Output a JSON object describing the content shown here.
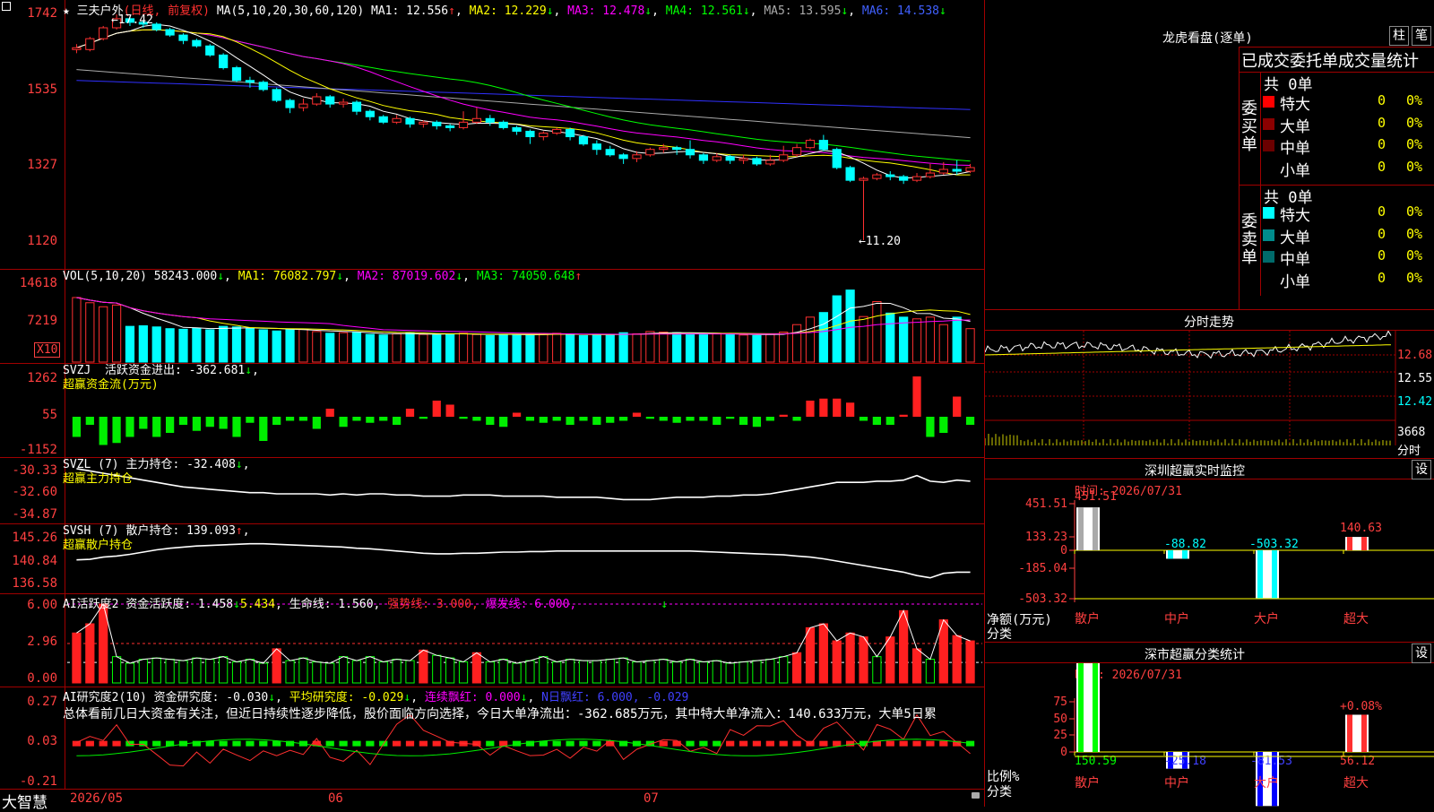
{
  "main_panel": {
    "title_icon": "star-icon",
    "stock_name": "三夫户外",
    "period": "(日线, 前复权)",
    "ma_header": "MA(5,10,20,30,60,120)",
    "ma1": "MA1: 12.556",
    "ma2": "MA2: 12.229",
    "ma3": "MA3: 12.478",
    "ma4": "MA4: 12.561",
    "ma5": "MA5: 13.595",
    "ma6": "MA6: 14.538",
    "high_label": "17.42",
    "low_label": "11.20",
    "y_ticks": [
      "1742",
      "1535",
      "1327",
      "1120"
    ],
    "colors": {
      "up": "#ff3030",
      "down": "#00ffff",
      "ma1": "#ffffff",
      "ma2": "#ffff00",
      "ma3": "#ff00ff",
      "ma4": "#00ff00",
      "ma5": "#aaaaaa",
      "ma6": "#3030ff"
    }
  },
  "vol_panel": {
    "header": "VOL(5,10,20)",
    "value": "58243.000",
    "ma1": "MA1: 76082.797",
    "ma2": "MA2: 87019.602",
    "ma3": "MA3: 74050.648",
    "y_ticks": [
      "14618",
      "7219"
    ],
    "unit": "X10"
  },
  "svzj_panel": {
    "header": "SVZJ",
    "line1": "活跃资金进出: -362.681",
    "line2": "超赢资金流(万元)",
    "y_ticks": [
      "1262",
      "55",
      "-1152"
    ]
  },
  "svzl_panel": {
    "header": "SVZL (7)",
    "line1": "主力持仓: -32.408",
    "line2": "超赢主力持仓",
    "y_ticks": [
      "-30.33",
      "-32.60",
      "-34.87"
    ]
  },
  "svsh_panel": {
    "header": "SVSH (7)",
    "line1": "散户持仓: 139.093",
    "line2": "超赢散户持仓",
    "y_ticks": [
      "145.26",
      "140.84",
      "136.58"
    ]
  },
  "ai_active_panel": {
    "header": "AI活跃度2",
    "line1": "资金活跃度: 1.458",
    "line2": "5.434",
    "line3": "生命线: 1.560,",
    "line4": "强势线: 3.000,",
    "line5": "爆发线: 6.000,",
    "y_ticks": [
      "6.00",
      "2.96",
      "0.00"
    ]
  },
  "ai_research_panel": {
    "header": "AI研究度2(10)",
    "line1": "资金研究度: -0.030",
    "line2": "平均研究度: -0.029",
    "line3": "连续飘红: 0.000",
    "line4": "N日飘红: 6.000, -0.029",
    "summary": "总体看前几日大资金有关注，但近日持续性逐步降低，股价面临方向选择，今日大单净流出：-362.685万元，其中特大单净流入：140.633万元，大单5日累",
    "y_ticks": [
      "0.27",
      "0.03",
      "-0.21"
    ]
  },
  "bottom_bar": {
    "brand": "大智慧",
    "dates": [
      "2026/05",
      "06",
      "07"
    ],
    "lock_icon": "lock-icon"
  },
  "longhu": {
    "title": "龙虎看盘(逐单)",
    "btn_bar": "柱",
    "btn_tick": "笔",
    "header": "已成交委托单成交量统计",
    "buy_total": "共 0单",
    "buy_label": "委买单",
    "sell_total": "共 0单",
    "sell_label": "委卖单",
    "buy_rows": [
      {
        "label": "特大",
        "count": "0",
        "pct": "0%",
        "color": "#ff0000"
      },
      {
        "label": "大单",
        "count": "0",
        "pct": "0%",
        "color": "#8b0000"
      },
      {
        "label": "中单",
        "count": "0",
        "pct": "0%",
        "color": "#6b0000"
      },
      {
        "label": "小单",
        "count": "0",
        "pct": "0%",
        "color": "#000000"
      }
    ],
    "sell_rows": [
      {
        "label": "特大",
        "count": "0",
        "pct": "0%",
        "color": "#00ffff"
      },
      {
        "label": "大单",
        "count": "0",
        "pct": "0%",
        "color": "#008b8b"
      },
      {
        "label": "中单",
        "count": "0",
        "pct": "0%",
        "color": "#006b6b"
      },
      {
        "label": "小单",
        "count": "0",
        "pct": "0%",
        "color": "#000000"
      }
    ]
  },
  "intraday": {
    "title": "分时走势",
    "y_ticks": [
      "12.68",
      "12.55",
      "12.42"
    ],
    "vol_tick": "3668",
    "vol_label": "分时"
  },
  "sz_monitor": {
    "title": "深圳超赢实时监控",
    "set_btn": "设",
    "time": "时间: 2026/07/31",
    "y_ticks": [
      "451.51",
      "133.23",
      "0",
      "-185.04",
      "-503.32"
    ],
    "unit_label": "净额(万元)",
    "cat_label": "分类",
    "categories": [
      "散户",
      "中户",
      "大户",
      "超大"
    ],
    "values": [
      "451.51",
      "-88.82",
      "-503.32",
      "140.63"
    ]
  },
  "sz_classify": {
    "title": "深市超赢分类统计",
    "set_btn": "设",
    "time": "时间: 2026/07/31",
    "y_ticks": [
      "75",
      "50",
      "25",
      "0"
    ],
    "unit_label": "比例%",
    "cat_label": "分类",
    "categories": [
      "散户",
      "中户",
      "大户",
      "超大"
    ],
    "values": [
      "150.59",
      "-25.18",
      "-81.53",
      "56.12"
    ],
    "top_value": "+0.08%"
  },
  "candles": [
    [
      16.45,
      16.5,
      16.35,
      16.6
    ],
    [
      16.45,
      16.75,
      16.4,
      16.8
    ],
    [
      16.75,
      17.05,
      16.7,
      17.1
    ],
    [
      17.05,
      17.3,
      17.0,
      17.42
    ],
    [
      17.3,
      17.2,
      17.1,
      17.35
    ],
    [
      17.2,
      17.15,
      17.05,
      17.25
    ],
    [
      17.15,
      17.0,
      16.95,
      17.2
    ],
    [
      17.0,
      16.85,
      16.8,
      17.05
    ],
    [
      16.85,
      16.7,
      16.6,
      16.9
    ],
    [
      16.7,
      16.55,
      16.5,
      16.75
    ],
    [
      16.55,
      16.3,
      16.25,
      16.6
    ],
    [
      16.3,
      15.95,
      15.9,
      16.35
    ],
    [
      15.95,
      15.6,
      15.55,
      16.0
    ],
    [
      15.6,
      15.55,
      15.4,
      15.7
    ],
    [
      15.55,
      15.35,
      15.3,
      15.6
    ],
    [
      15.35,
      15.05,
      15.0,
      15.4
    ],
    [
      15.05,
      14.85,
      14.7,
      15.1
    ],
    [
      14.85,
      14.95,
      14.75,
      15.1
    ],
    [
      14.95,
      15.15,
      14.9,
      15.25
    ],
    [
      15.15,
      14.95,
      14.85,
      15.2
    ],
    [
      14.95,
      15.0,
      14.85,
      15.1
    ],
    [
      15.0,
      14.75,
      14.65,
      15.05
    ],
    [
      14.75,
      14.6,
      14.5,
      14.8
    ],
    [
      14.6,
      14.45,
      14.4,
      14.65
    ],
    [
      14.45,
      14.55,
      14.4,
      14.65
    ],
    [
      14.55,
      14.4,
      14.3,
      14.6
    ],
    [
      14.4,
      14.45,
      14.3,
      14.5
    ],
    [
      14.45,
      14.35,
      14.25,
      14.5
    ],
    [
      14.35,
      14.3,
      14.2,
      14.4
    ],
    [
      14.3,
      14.45,
      14.25,
      14.75
    ],
    [
      14.45,
      14.55,
      14.4,
      14.85
    ],
    [
      14.55,
      14.45,
      14.35,
      14.65
    ],
    [
      14.45,
      14.3,
      14.25,
      14.5
    ],
    [
      14.3,
      14.2,
      14.1,
      14.35
    ],
    [
      14.2,
      14.05,
      13.85,
      14.25
    ],
    [
      14.05,
      14.15,
      13.95,
      14.2
    ],
    [
      14.15,
      14.25,
      14.1,
      14.3
    ],
    [
      14.25,
      14.05,
      13.95,
      14.3
    ],
    [
      14.05,
      13.85,
      13.8,
      14.1
    ],
    [
      13.85,
      13.7,
      13.55,
      13.95
    ],
    [
      13.7,
      13.55,
      13.5,
      13.8
    ],
    [
      13.55,
      13.45,
      13.3,
      13.6
    ],
    [
      13.45,
      13.55,
      13.35,
      13.65
    ],
    [
      13.55,
      13.7,
      13.5,
      13.75
    ],
    [
      13.7,
      13.75,
      13.6,
      13.85
    ],
    [
      13.75,
      13.7,
      13.55,
      13.8
    ],
    [
      13.7,
      13.55,
      13.45,
      13.95
    ],
    [
      13.55,
      13.4,
      13.3,
      13.6
    ],
    [
      13.4,
      13.5,
      13.35,
      13.6
    ],
    [
      13.5,
      13.4,
      13.3,
      13.55
    ],
    [
      13.4,
      13.45,
      13.3,
      13.55
    ],
    [
      13.45,
      13.3,
      13.25,
      13.5
    ],
    [
      13.3,
      13.4,
      13.25,
      13.55
    ],
    [
      13.4,
      13.55,
      13.35,
      13.8
    ],
    [
      13.55,
      13.75,
      13.5,
      13.85
    ],
    [
      13.75,
      13.95,
      13.7,
      14.0
    ],
    [
      13.95,
      13.7,
      13.65,
      14.1
    ],
    [
      13.7,
      13.2,
      13.15,
      13.75
    ],
    [
      13.2,
      12.85,
      12.8,
      13.25
    ],
    [
      12.85,
      12.9,
      11.2,
      12.95
    ],
    [
      12.9,
      13.0,
      12.85,
      13.05
    ],
    [
      13.0,
      12.95,
      12.85,
      13.1
    ],
    [
      12.95,
      12.85,
      12.75,
      13.0
    ],
    [
      12.85,
      12.95,
      12.8,
      13.05
    ],
    [
      12.95,
      13.05,
      12.9,
      13.3
    ],
    [
      13.05,
      13.15,
      13.0,
      13.35
    ],
    [
      13.15,
      13.1,
      13.0,
      13.4
    ],
    [
      13.1,
      13.2,
      13.05,
      13.3
    ]
  ],
  "volumes": [
    11200,
    10300,
    9600,
    9900,
    6200,
    6300,
    6100,
    5800,
    5700,
    5900,
    5600,
    6200,
    6100,
    5900,
    5600,
    5400,
    5600,
    5700,
    5300,
    5000,
    5100,
    5200,
    4800,
    4700,
    4900,
    5100,
    4800,
    4700,
    4900,
    5000,
    4800,
    4600,
    4800,
    4700,
    4800,
    4900,
    5000,
    4800,
    4600,
    4700,
    4800,
    5100,
    4900,
    5300,
    5200,
    5100,
    4900,
    4800,
    5000,
    4800,
    4700,
    4600,
    4800,
    5200,
    6500,
    7800,
    8600,
    11500,
    12500,
    7900,
    10500,
    8500,
    7800,
    7500,
    7800,
    6500,
    7800,
    5800
  ],
  "svzj": [
    -500,
    -200,
    -700,
    -650,
    -500,
    -300,
    -500,
    -400,
    -200,
    -350,
    -250,
    -300,
    -500,
    -150,
    -600,
    -200,
    -100,
    -100,
    -300,
    200,
    -250,
    -100,
    -150,
    -100,
    -200,
    200,
    -50,
    400,
    300,
    -50,
    -100,
    -200,
    -250,
    100,
    -100,
    -150,
    -100,
    -200,
    -100,
    -200,
    -150,
    -100,
    100,
    -50,
    -100,
    -150,
    -100,
    -100,
    -200,
    -50,
    -200,
    -250,
    -100,
    50,
    -100,
    400,
    450,
    450,
    350,
    -100,
    -200,
    -200,
    50,
    1000,
    -500,
    -400,
    500,
    -200,
    -250,
    -300
  ],
  "svzl": [
    -30.4,
    -30.6,
    -30.8,
    -31.0,
    -31.2,
    -31.4,
    -31.6,
    -31.8,
    -32.0,
    -32.1,
    -32.2,
    -32.3,
    -32.4,
    -32.5,
    -32.5,
    -32.6,
    -32.6,
    -32.6,
    -32.6,
    -32.7,
    -32.6,
    -32.7,
    -32.6,
    -32.6,
    -32.7,
    -32.7,
    -32.8,
    -32.8,
    -32.8,
    -32.7,
    -32.7,
    -32.7,
    -32.8,
    -32.8,
    -32.8,
    -32.8,
    -32.9,
    -32.9,
    -32.9,
    -32.9,
    -33.0,
    -33.1,
    -33.1,
    -33.1,
    -33.0,
    -32.9,
    -32.9,
    -32.9,
    -32.8,
    -32.8,
    -32.7,
    -32.7,
    -32.6,
    -32.4,
    -32.2,
    -32.0,
    -31.8,
    -31.6,
    -31.6,
    -31.6,
    -31.5,
    -31.5,
    -31.4,
    -31.0,
    -31.5,
    -31.6,
    -31.4,
    -31.5,
    -31.6,
    -32.0
  ],
  "svsh": [
    140.8,
    140.9,
    141.3,
    141.5,
    141.8,
    142.2,
    142.6,
    142.9,
    143.1,
    143.3,
    143.4,
    143.5,
    143.6,
    143.7,
    143.7,
    143.6,
    143.5,
    143.4,
    143.3,
    143.2,
    143.1,
    142.9,
    142.8,
    142.6,
    142.4,
    142.2,
    142.0,
    141.9,
    141.9,
    142.0,
    142.0,
    142.1,
    142.2,
    142.2,
    142.3,
    142.3,
    142.4,
    142.4,
    142.4,
    142.4,
    142.4,
    142.4,
    142.4,
    142.4,
    142.4,
    142.4,
    142.4,
    142.3,
    142.2,
    142.1,
    142.0,
    141.9,
    141.8,
    141.7,
    141.5,
    141.3,
    141.0,
    140.6,
    140.2,
    139.8,
    139.4,
    139.0,
    138.6,
    138.0,
    137.6,
    138.4,
    138.6,
    138.6,
    138.6,
    138.7
  ],
  "ai_active": [
    3.8,
    4.5,
    6.0,
    2.0,
    1.5,
    1.8,
    1.9,
    1.8,
    1.7,
    1.9,
    1.8,
    2.0,
    1.6,
    1.8,
    1.5,
    2.6,
    1.7,
    1.9,
    1.6,
    1.5,
    2.0,
    1.7,
    2.0,
    1.6,
    1.8,
    1.7,
    2.5,
    2.1,
    1.9,
    1.6,
    2.3,
    1.6,
    1.8,
    1.5,
    1.7,
    2.0,
    1.6,
    1.8,
    1.7,
    1.7,
    1.8,
    1.9,
    1.6,
    1.7,
    1.8,
    1.6,
    1.8,
    1.6,
    1.7,
    1.5,
    1.6,
    1.7,
    1.8,
    2.0,
    2.3,
    4.2,
    4.5,
    3.2,
    3.8,
    3.5,
    2.0,
    3.5,
    5.5,
    2.6,
    1.8,
    4.8,
    3.6,
    3.2,
    3.0,
    1.8
  ],
  "ai_research": [
    0.02,
    0.03,
    0.02,
    0.05,
    0.01,
    0.01,
    -0.01,
    -0.03,
    -0.03,
    0.0,
    -0.02,
    0.01,
    0.0,
    -0.01,
    0.01,
    0.0,
    0.01,
    0.0,
    0.03,
    -0.01,
    -0.02,
    0.0,
    -0.03,
    0.01,
    0.05,
    0.07,
    0.04,
    0.03,
    0.02,
    0.02,
    0.02,
    0.0,
    0.02,
    0.01,
    0.0,
    0.0,
    0.01,
    -0.01,
    0.01,
    0.0,
    0.02,
    -0.02,
    0.0,
    0.01,
    0.02,
    0.02,
    0.0,
    0.01,
    0.0,
    0.05,
    0.04,
    0.06,
    0.06,
    0.07,
    0.04,
    0.02,
    0.05,
    0.06,
    0.03,
    0.0,
    0.05,
    0.04,
    0.02,
    0.07,
    0.03,
    0.04,
    0.02,
    0.0,
    0.0,
    -0.02
  ]
}
